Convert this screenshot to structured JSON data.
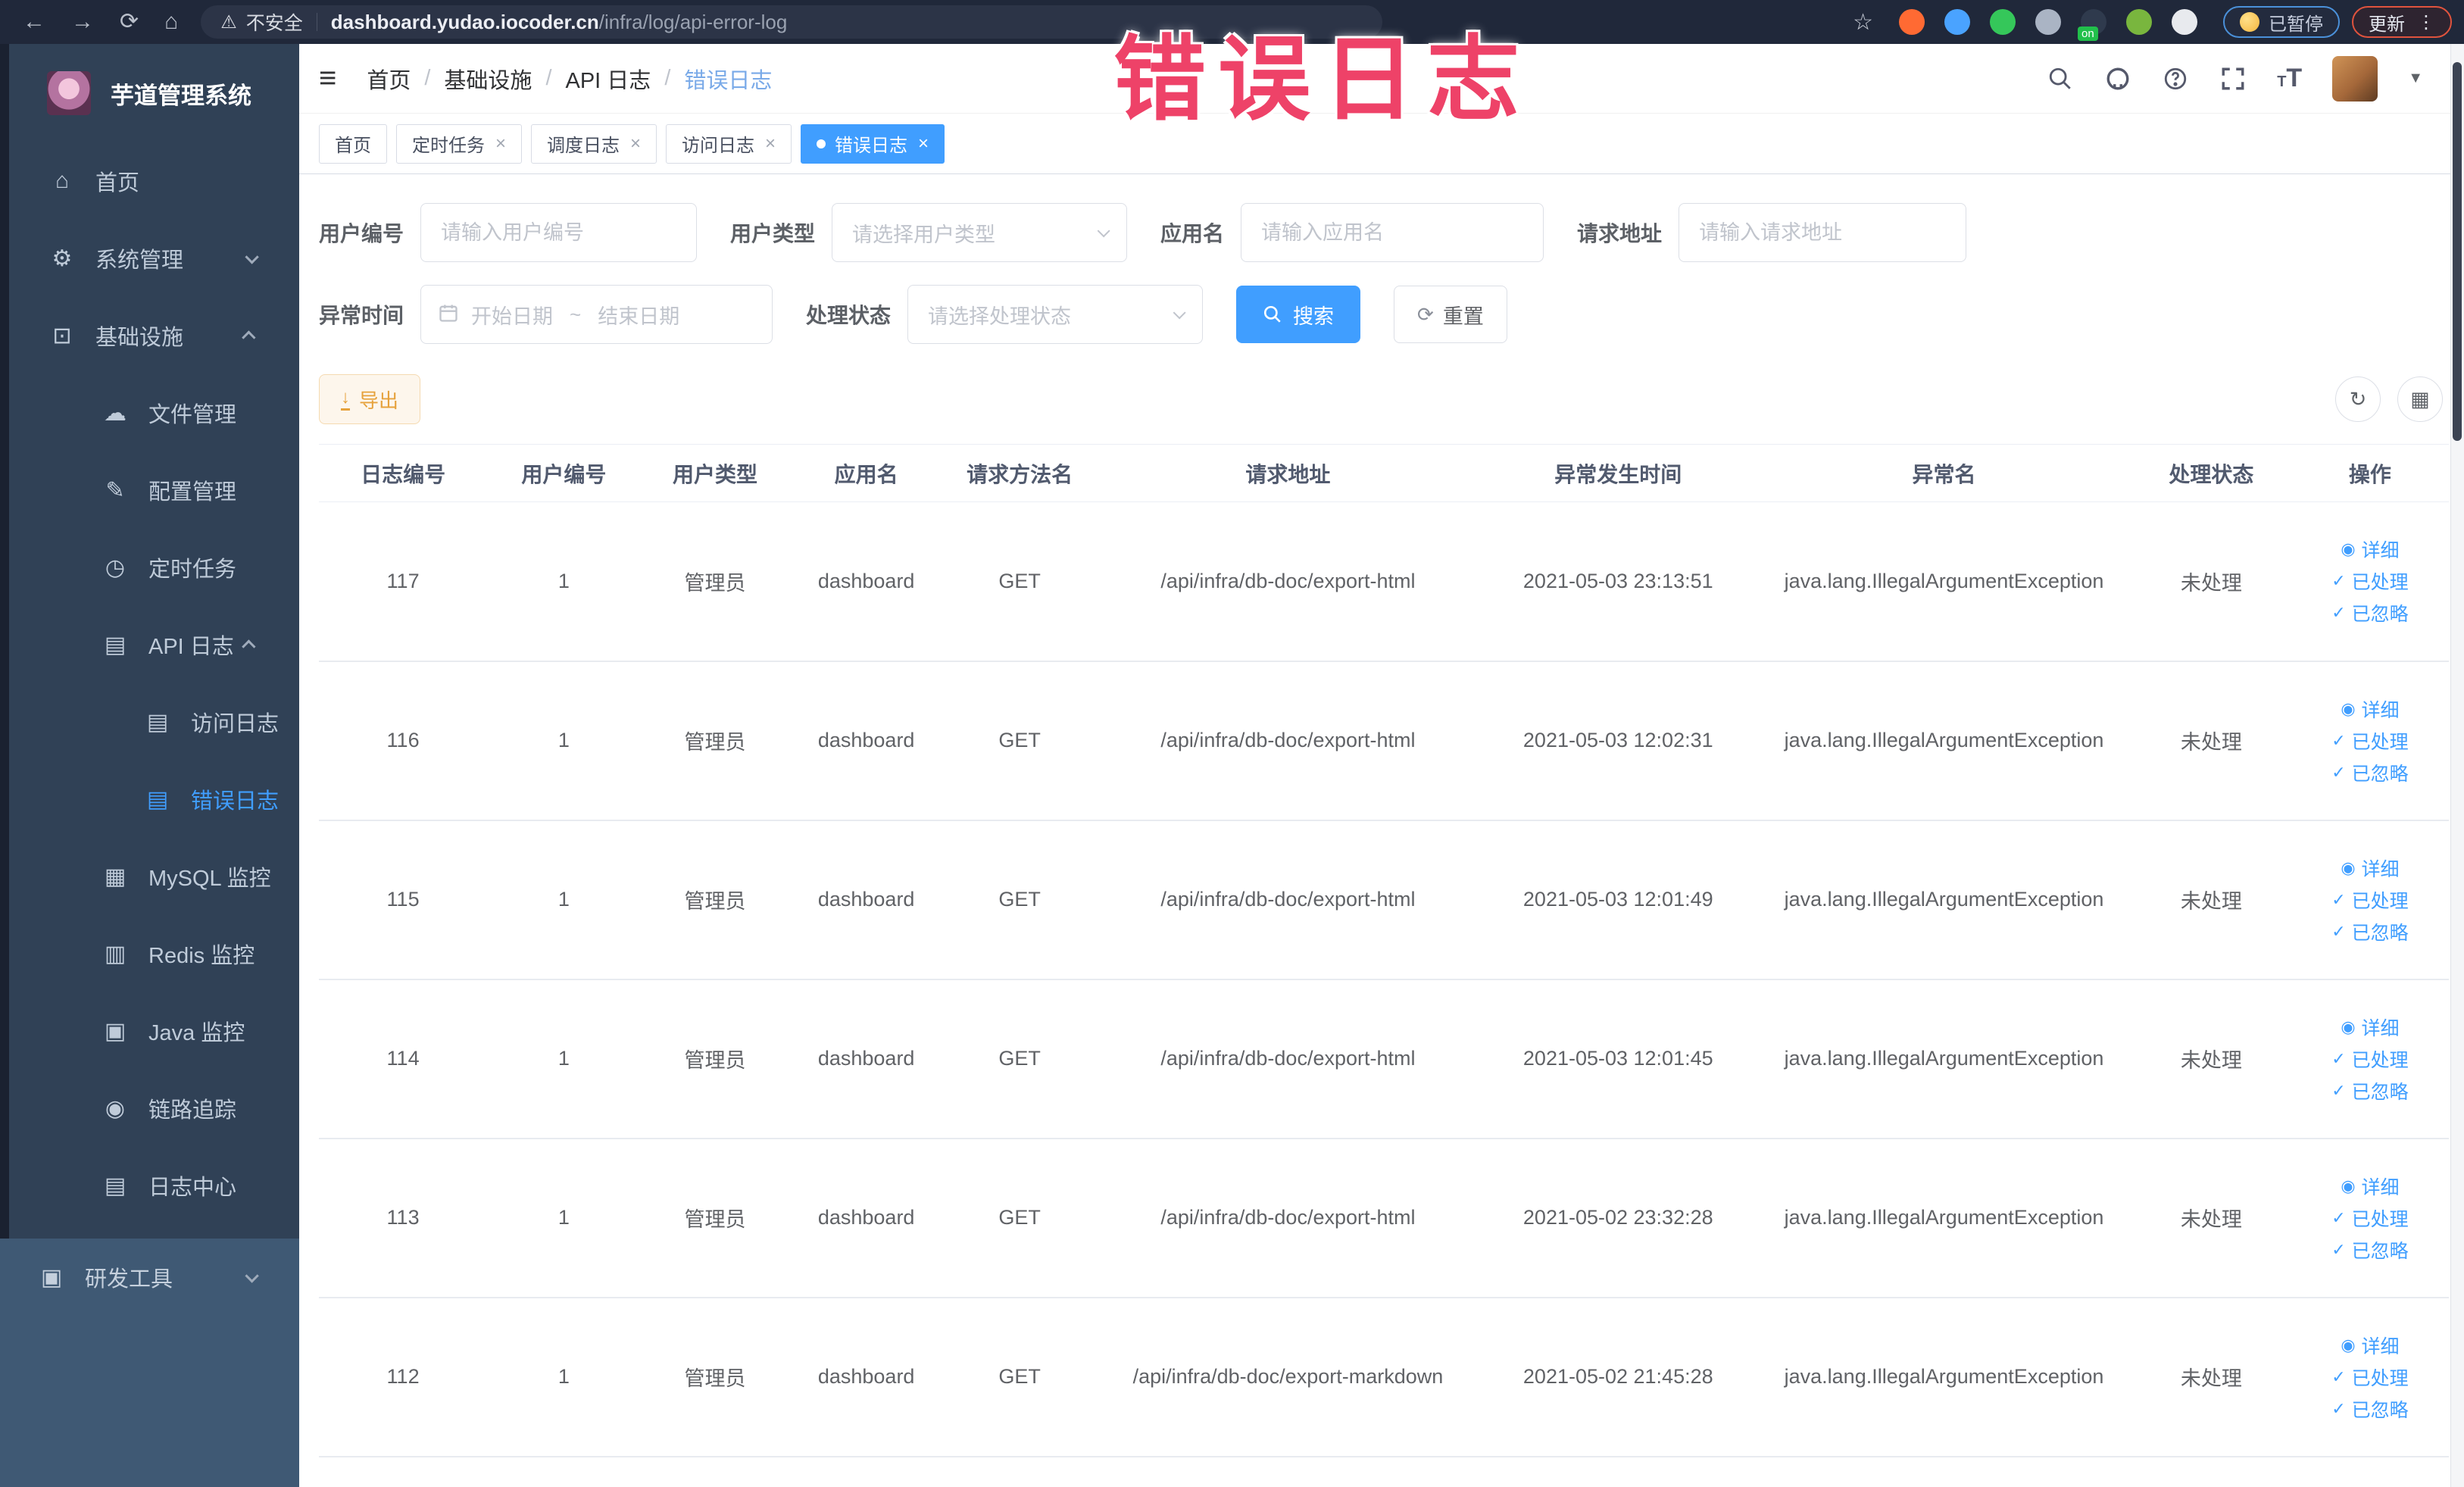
{
  "colors": {
    "accent": "#409eff",
    "sidebar_bg": "#304156",
    "toolbar_bg": "#20283a",
    "annotation": "#ee4268",
    "warning_text": "#e6a23c"
  },
  "browser": {
    "security_label": "不安全",
    "url_domain": "dashboard.yudao.iocoder.cn",
    "url_path": "/infra/log/api-error-log",
    "paused_label": "已暂停",
    "update_label": "更新",
    "extensions": [
      {
        "name": "adblock-extension-icon",
        "color": "#ff6a33"
      },
      {
        "name": "shield-extension-icon",
        "color": "#4aa3ff"
      },
      {
        "name": "green-v-extension-icon",
        "color": "#35c75a"
      },
      {
        "name": "grid-extension-icon",
        "color": "#aab4c4"
      },
      {
        "name": "switch-extension-icon",
        "color": "#2f3a4d",
        "badge": "on",
        "badge_color": "#21c04b"
      },
      {
        "name": "leaf-extension-icon",
        "color": "#79b63e"
      },
      {
        "name": "puzzle-extension-icon",
        "color": "#e8eaee"
      }
    ]
  },
  "annotation": {
    "text": "错误日志"
  },
  "sidebar": {
    "title": "芋道管理系统",
    "items": [
      {
        "key": "home",
        "label": "首页",
        "glyph": "⌂",
        "level": 1
      },
      {
        "key": "system-management",
        "label": "系统管理",
        "glyph": "⚙",
        "level": 1,
        "arrow": "down"
      },
      {
        "key": "infrastructure",
        "label": "基础设施",
        "glyph": "⊡",
        "level": 1,
        "arrow": "up"
      },
      {
        "key": "file-management",
        "label": "文件管理",
        "glyph": "☁",
        "level": 2
      },
      {
        "key": "config-management",
        "label": "配置管理",
        "glyph": "✎",
        "level": 2
      },
      {
        "key": "scheduled-tasks",
        "label": "定时任务",
        "glyph": "◷",
        "level": 2
      },
      {
        "key": "api-log",
        "label": "API 日志",
        "glyph": "▤",
        "level": 2,
        "arrow": "up"
      },
      {
        "key": "access-log",
        "label": "访问日志",
        "glyph": "▤",
        "level": 3
      },
      {
        "key": "error-log",
        "label": "错误日志",
        "glyph": "▤",
        "level": 3,
        "active": true
      },
      {
        "key": "mysql-monitor",
        "label": "MySQL 监控",
        "glyph": "▦",
        "level": 2
      },
      {
        "key": "redis-monitor",
        "label": "Redis 监控",
        "glyph": "▥",
        "level": 2
      },
      {
        "key": "java-monitor",
        "label": "Java 监控",
        "glyph": "▣",
        "level": 2
      },
      {
        "key": "tracing",
        "label": "链路追踪",
        "glyph": "◉",
        "level": 2
      },
      {
        "key": "log-center",
        "label": "日志中心",
        "glyph": "▤",
        "level": 2
      }
    ],
    "bottom_item": {
      "key": "dev-tools",
      "label": "研发工具",
      "glyph": "▣",
      "level": 1,
      "arrow": "down"
    }
  },
  "header": {
    "breadcrumb": [
      "首页",
      "基础设施",
      "API 日志",
      "错误日志"
    ],
    "font_size_icon_text": "T"
  },
  "tabs": [
    {
      "label": "首页"
    },
    {
      "label": "定时任务",
      "closable": true
    },
    {
      "label": "调度日志",
      "closable": true
    },
    {
      "label": "访问日志",
      "closable": true
    },
    {
      "label": "错误日志",
      "closable": true,
      "active": true
    }
  ],
  "filters": {
    "user_id": {
      "label": "用户编号",
      "placeholder": "请输入用户编号"
    },
    "user_type": {
      "label": "用户类型",
      "placeholder": "请选择用户类型"
    },
    "app_name": {
      "label": "应用名",
      "placeholder": "请输入应用名"
    },
    "request_url": {
      "label": "请求地址",
      "placeholder": "请输入请求地址"
    },
    "exception_time": {
      "label": "异常时间",
      "start_placeholder": "开始日期",
      "separator": "~",
      "end_placeholder": "结束日期"
    },
    "process_status": {
      "label": "处理状态",
      "placeholder": "请选择处理状态"
    },
    "search_label": "搜索",
    "reset_label": "重置"
  },
  "actions_bar": {
    "export_label": "导出"
  },
  "table": {
    "columns": [
      {
        "key": "id",
        "label": "日志编号",
        "width": "7.9%"
      },
      {
        "key": "user_id",
        "label": "用户编号",
        "width": "7.2%"
      },
      {
        "key": "user_type",
        "label": "用户类型",
        "width": "7.0%"
      },
      {
        "key": "app",
        "label": "应用名",
        "width": "7.2%"
      },
      {
        "key": "method",
        "label": "请求方法名",
        "width": "7.2%"
      },
      {
        "key": "url",
        "label": "请求地址",
        "width": "18.0%"
      },
      {
        "key": "time",
        "label": "异常发生时间",
        "width": "13.0%"
      },
      {
        "key": "exception",
        "label": "异常名",
        "width": "17.6%"
      },
      {
        "key": "status",
        "label": "处理状态",
        "width": "7.5%"
      },
      {
        "key": "actions",
        "label": "操作",
        "width": "7.4%"
      }
    ],
    "row_actions": [
      {
        "key": "detail",
        "label": "详细",
        "glyph": "◉"
      },
      {
        "key": "processed",
        "label": "已处理",
        "glyph": "✓"
      },
      {
        "key": "ignored",
        "label": "已忽略",
        "glyph": "✓"
      }
    ],
    "rows": [
      {
        "id": "117",
        "user_id": "1",
        "user_type": "管理员",
        "app": "dashboard",
        "method": "GET",
        "url": "/api/infra/db-doc/export-html",
        "time": "2021-05-03 23:13:51",
        "exception": "java.lang.IllegalArgumentException",
        "status": "未处理"
      },
      {
        "id": "116",
        "user_id": "1",
        "user_type": "管理员",
        "app": "dashboard",
        "method": "GET",
        "url": "/api/infra/db-doc/export-html",
        "time": "2021-05-03 12:02:31",
        "exception": "java.lang.IllegalArgumentException",
        "status": "未处理"
      },
      {
        "id": "115",
        "user_id": "1",
        "user_type": "管理员",
        "app": "dashboard",
        "method": "GET",
        "url": "/api/infra/db-doc/export-html",
        "time": "2021-05-03 12:01:49",
        "exception": "java.lang.IllegalArgumentException",
        "status": "未处理"
      },
      {
        "id": "114",
        "user_id": "1",
        "user_type": "管理员",
        "app": "dashboard",
        "method": "GET",
        "url": "/api/infra/db-doc/export-html",
        "time": "2021-05-03 12:01:45",
        "exception": "java.lang.IllegalArgumentException",
        "status": "未处理"
      },
      {
        "id": "113",
        "user_id": "1",
        "user_type": "管理员",
        "app": "dashboard",
        "method": "GET",
        "url": "/api/infra/db-doc/export-html",
        "time": "2021-05-02 23:32:28",
        "exception": "java.lang.IllegalArgumentException",
        "status": "未处理"
      },
      {
        "id": "112",
        "user_id": "1",
        "user_type": "管理员",
        "app": "dashboard",
        "method": "GET",
        "url": "/api/infra/db-doc/export-markdown",
        "time": "2021-05-02 21:45:28",
        "exception": "java.lang.IllegalArgumentException",
        "status": "未处理"
      }
    ]
  }
}
